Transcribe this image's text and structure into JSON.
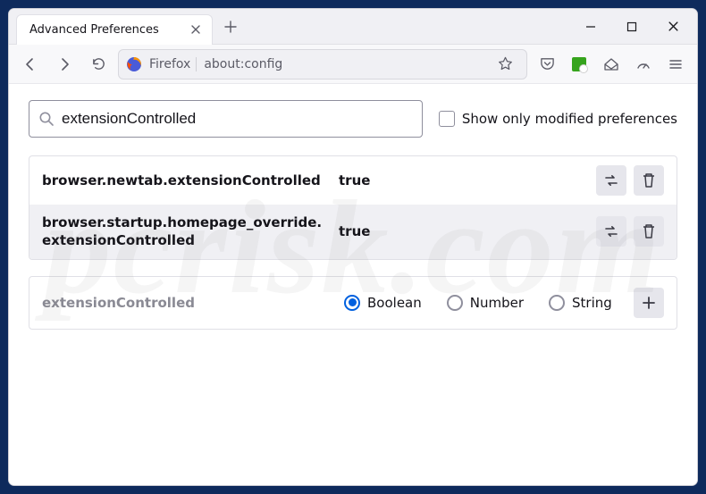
{
  "tab": {
    "title": "Advanced Preferences"
  },
  "address": {
    "brand": "Firefox",
    "url": "about:config"
  },
  "search": {
    "value": "extensionControlled",
    "show_modified": "Show only modified preferences"
  },
  "prefs": [
    {
      "name": "browser.newtab.extensionControlled",
      "value": "true"
    },
    {
      "name": "browser.startup.homepage_override.extensionControlled",
      "value": "true"
    }
  ],
  "newpref": {
    "name": "extensionControlled",
    "types": {
      "boolean": "Boolean",
      "number": "Number",
      "string": "String"
    }
  },
  "watermark": "pcrisk.com"
}
